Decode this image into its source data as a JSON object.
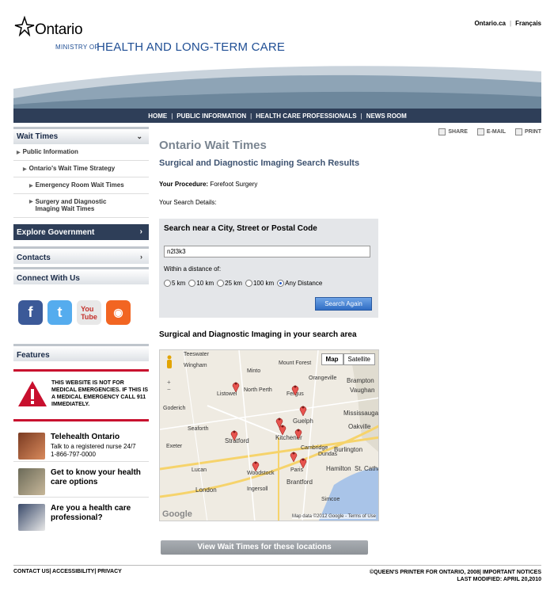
{
  "header": {
    "logo_text": "Ontario",
    "ministry_small": "MINISTRY OF",
    "ministry_big": "HEALTH AND LONG-TERM CARE",
    "top_links": [
      "Ontario.ca",
      "Français"
    ]
  },
  "nav": [
    "HOME",
    "PUBLIC INFORMATION",
    "HEALTH CARE PROFESSIONALS",
    "NEWS ROOM"
  ],
  "sidebar": {
    "wait_times": "Wait Times",
    "items": [
      "Public Information",
      "Ontario's Wait Time Strategy",
      "Emergency Room Wait Times",
      "Surgery and Diagnostic Imaging Wait Times"
    ],
    "explore": "Explore Government",
    "contacts": "Contacts",
    "connect": "Connect With Us",
    "social_icons": [
      "facebook-icon",
      "twitter-icon",
      "youtube-icon",
      "rss-icon"
    ],
    "features": "Features",
    "warning": "THIS WEBSITE IS NOT FOR MEDICAL EMERGENCIES. IF THIS IS A MEDICAL EMERGENCY CALL 911 IMMEDIATELY.",
    "feature_items": [
      {
        "title": "Telehealth Ontario",
        "sub": "Talk to a registered nurse 24/7",
        "phone": "1-866-797-0000"
      },
      {
        "title": "Get to know your health care options"
      },
      {
        "title": "Are you a health care professional?"
      }
    ]
  },
  "utility": {
    "share": "SHARE",
    "email": "E-MAIL",
    "print": "PRINT"
  },
  "main": {
    "title": "Ontario Wait Times",
    "subtitle": "Surgical and Diagnostic Imaging Search Results",
    "procedure_label": "Your Procedure:",
    "procedure_value": "Forefoot Surgery",
    "details_label": "Your Search Details:"
  },
  "search": {
    "title": "Search near a City, Street or Postal Code",
    "value": "n2l3k3",
    "within": "Within a distance of:",
    "options": [
      "5 km",
      "10 km",
      "25 km",
      "100 km",
      "Any Distance"
    ],
    "selected": "Any Distance",
    "button": "Search Again"
  },
  "map": {
    "title": "Surgical and Diagnostic Imaging in your search area",
    "type_buttons": [
      "Map",
      "Satellite"
    ],
    "credit": "Map data ©2012 Google - Terms of Use",
    "google": "Google",
    "cities": [
      "Teeswater",
      "Wingham",
      "Mount Forest",
      "Minto",
      "Orangeville",
      "Brampton",
      "Listowel",
      "North Perth",
      "Fergus",
      "Vaughan",
      "Mississauga",
      "Oakville",
      "Burlington",
      "Hamilton",
      "St. Catharines",
      "Guelph",
      "Kitchener",
      "Cambridge",
      "Stratford",
      "Woodstock",
      "Brantford",
      "Dundas",
      "Paris",
      "London",
      "Ingersoll",
      "Simcoe",
      "Lucan",
      "Seaforth",
      "Goderich",
      "Exeter"
    ]
  },
  "view_button": "View Wait Times for these locations",
  "footer": {
    "left": [
      "CONTACT US",
      "ACCESSIBILITY",
      "PRIVACY"
    ],
    "right1": "©QUEEN'S PRINTER FOR ONTARIO, 2008| IMPORTANT NOTICES",
    "right2": "LAST MODIFIED: APRIL 20,2010"
  }
}
